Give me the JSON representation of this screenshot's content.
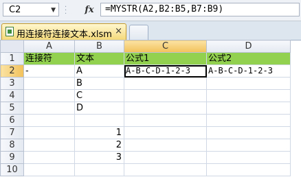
{
  "formula_bar": {
    "name_box": "C2",
    "fx_label": "fx",
    "formula": "=MYSTR(A2,B2:B5,B7:B9)"
  },
  "tabs": {
    "file_tab_label": "用连接符连接文本.xlsm",
    "close_glyph": "×"
  },
  "grid": {
    "columns": [
      "A",
      "B",
      "C",
      "D"
    ],
    "rows": [
      {
        "n": "1",
        "cells": [
          "连接符",
          "文本",
          "公式1",
          "公式2"
        ]
      },
      {
        "n": "2",
        "cells": [
          "-",
          "A",
          "A-B-C-D-1-2-3",
          "A-B-C-D-1-2-3"
        ]
      },
      {
        "n": "3",
        "cells": [
          "",
          "B",
          "",
          ""
        ]
      },
      {
        "n": "4",
        "cells": [
          "",
          "C",
          "",
          ""
        ]
      },
      {
        "n": "5",
        "cells": [
          "",
          "D",
          "",
          ""
        ]
      },
      {
        "n": "6",
        "cells": [
          "",
          "",
          "",
          ""
        ]
      },
      {
        "n": "7",
        "cells": [
          "",
          "1",
          "",
          ""
        ]
      },
      {
        "n": "8",
        "cells": [
          "",
          "2",
          "",
          ""
        ]
      },
      {
        "n": "9",
        "cells": [
          "",
          "3",
          "",
          ""
        ]
      },
      {
        "n": "10",
        "cells": [
          "",
          "",
          "",
          ""
        ]
      }
    ]
  },
  "colors": {
    "header_fill": "#92d050",
    "selection": "#f2c15a"
  }
}
